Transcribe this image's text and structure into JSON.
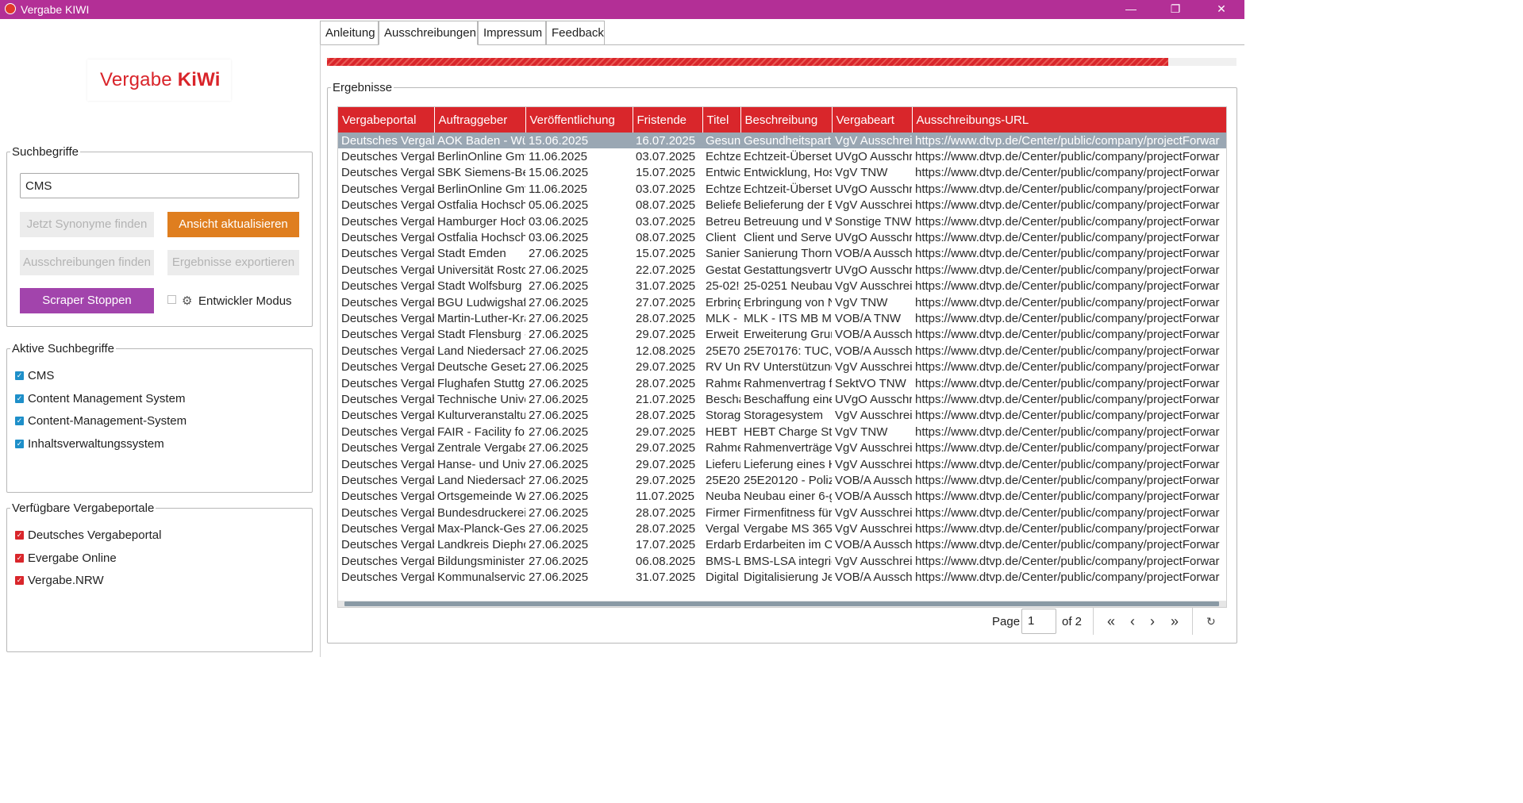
{
  "window": {
    "title": "Vergabe KIWI",
    "controls": {
      "minimize": "—",
      "maximize": "❐",
      "close": "✕"
    }
  },
  "logo": {
    "part1": "Vergabe ",
    "part2": "KiWi"
  },
  "suchbegriffe": {
    "legend": "Suchbegriffe",
    "input_value": "CMS",
    "btn_synonyme": "Jetzt Synonyme finden",
    "btn_aktualisieren": "Ansicht aktualisieren",
    "btn_finden": "Ausschreibungen finden",
    "btn_export": "Ergebnisse exportieren",
    "btn_stoppen": "Scraper Stoppen",
    "dev_mode": "Entwickler Modus"
  },
  "aktive": {
    "legend": "Aktive Suchbegriffe",
    "items": [
      "CMS",
      "Content Management System",
      "Content-Management-System",
      "Inhaltsverwaltungssystem"
    ]
  },
  "portale": {
    "legend": "Verfügbare Vergabeportale",
    "items": [
      "Deutsches Vergabeportal",
      "Evergabe Online",
      "Vergabe.NRW"
    ]
  },
  "tabs": [
    "Anleitung",
    "Ausschreibungen",
    "Impressum",
    "Feedback"
  ],
  "progress_fraction": 0.925,
  "ergebnisse": {
    "legend": "Ergebnisse",
    "columns": [
      "Vergabeportal",
      "Auftraggeber",
      "Veröffentlichung",
      "Fristende",
      "Titel",
      "Beschreibung",
      "Vergabeart",
      "Ausschreibungs-URL"
    ],
    "rows": [
      [
        "Deutsches Vergab",
        "AOK Baden - Wü",
        "15.06.2025",
        "16.07.2025",
        "Gesun",
        "Gesundheitspartr",
        "VgV Ausschrei",
        "https://www.dtvp.de/Center/public/company/projectForwar"
      ],
      [
        "Deutsches Vergab",
        "BerlinOnline Gmt",
        "11.06.2025",
        "03.07.2025",
        "Echtze",
        "Echtzeit-Übersetz",
        "UVgO Ausschr",
        "https://www.dtvp.de/Center/public/company/projectForwar"
      ],
      [
        "Deutsches Vergab",
        "SBK Siemens-Bet",
        "15.06.2025",
        "15.07.2025",
        "Entwic",
        "Entwicklung, Hos",
        "VgV TNW",
        "https://www.dtvp.de/Center/public/company/projectForwar"
      ],
      [
        "Deutsches Vergab",
        "BerlinOnline Gmt",
        "11.06.2025",
        "03.07.2025",
        "Echtze",
        "Echtzeit-Übersetz",
        "UVgO Ausschr",
        "https://www.dtvp.de/Center/public/company/projectForwar"
      ],
      [
        "Deutsches Vergab",
        "Ostfalia Hochsch",
        "05.06.2025",
        "08.07.2025",
        "Beliefe",
        "Belieferung der B",
        "VgV Ausschrei",
        "https://www.dtvp.de/Center/public/company/projectForwar"
      ],
      [
        "Deutsches Vergab",
        "Hamburger Hoch",
        "03.06.2025",
        "03.07.2025",
        "Betreu",
        "Betreuung und W",
        "Sonstige TNW",
        "https://www.dtvp.de/Center/public/company/projectForwar"
      ],
      [
        "Deutsches Vergab",
        "Ostfalia Hochsch",
        "03.06.2025",
        "08.07.2025",
        "Client",
        "Client und Server",
        "UVgO Ausschr",
        "https://www.dtvp.de/Center/public/company/projectForwar"
      ],
      [
        "Deutsches Vergab",
        "Stadt Emden",
        "27.06.2025",
        "15.07.2025",
        "Sanier",
        "Sanierung Thorn",
        "VOB/A Aussch",
        "https://www.dtvp.de/Center/public/company/projectForwar"
      ],
      [
        "Deutsches Vergab",
        "Universität Rostc",
        "27.06.2025",
        "22.07.2025",
        "Gestat",
        "Gestattungsvertr",
        "UVgO Ausschr",
        "https://www.dtvp.de/Center/public/company/projectForwar"
      ],
      [
        "Deutsches Vergab",
        "Stadt Wolfsburg",
        "27.06.2025",
        "31.07.2025",
        "25-02!",
        "25-0251 Neubau",
        "VgV Ausschrei",
        "https://www.dtvp.de/Center/public/company/projectForwar"
      ],
      [
        "Deutsches Vergab",
        "BGU Ludwigshafe",
        "27.06.2025",
        "27.07.2025",
        "Erbring",
        "Erbringung von N",
        "VgV TNW",
        "https://www.dtvp.de/Center/public/company/projectForwar"
      ],
      [
        "Deutsches Vergab",
        "Martin-Luther-Kra",
        "27.06.2025",
        "28.07.2025",
        "MLK -",
        "MLK - ITS MB Mk",
        "VOB/A TNW",
        "https://www.dtvp.de/Center/public/company/projectForwar"
      ],
      [
        "Deutsches Vergab",
        "Stadt Flensburg -",
        "27.06.2025",
        "29.07.2025",
        "Erweit",
        "Erweiterung Grur",
        "VOB/A Aussch",
        "https://www.dtvp.de/Center/public/company/projectForwar"
      ],
      [
        "Deutsches Vergab",
        "Land Niedersach:",
        "27.06.2025",
        "12.08.2025",
        "25E70",
        "25E70176: TUC, v",
        "VOB/A Aussch",
        "https://www.dtvp.de/Center/public/company/projectForwar"
      ],
      [
        "Deutsches Vergab",
        "Deutsche Gesetzl",
        "27.06.2025",
        "29.07.2025",
        "RV Un",
        "RV Unterstützung",
        "VgV Ausschrei",
        "https://www.dtvp.de/Center/public/company/projectForwar"
      ],
      [
        "Deutsches Vergab",
        "Flughafen Stuttg",
        "27.06.2025",
        "28.07.2025",
        "Rahme",
        "Rahmenvertrag f",
        "SektVO TNW",
        "https://www.dtvp.de/Center/public/company/projectForwar"
      ],
      [
        "Deutsches Vergab",
        "Technische Unive",
        "27.06.2025",
        "21.07.2025",
        "Bescha",
        "Beschaffung eine",
        "UVgO Ausschr",
        "https://www.dtvp.de/Center/public/company/projectForwar"
      ],
      [
        "Deutsches Vergab",
        "Kulturveranstaltu",
        "27.06.2025",
        "28.07.2025",
        "Storag",
        "Storagesystem",
        "VgV Ausschrei",
        "https://www.dtvp.de/Center/public/company/projectForwar"
      ],
      [
        "Deutsches Vergab",
        "FAIR - Facility for",
        "27.06.2025",
        "29.07.2025",
        "HEBT (",
        "HEBT Charge Stri",
        "VgV TNW",
        "https://www.dtvp.de/Center/public/company/projectForwar"
      ],
      [
        "Deutsches Vergab",
        "Zentrale Vergabe",
        "27.06.2025",
        "29.07.2025",
        "Rahme",
        "Rahmenverträge",
        "VgV Ausschrei",
        "https://www.dtvp.de/Center/public/company/projectForwar"
      ],
      [
        "Deutsches Vergab",
        "Hanse- und Univ",
        "27.06.2025",
        "29.07.2025",
        "Lieferu",
        "Lieferung eines H",
        "VgV Ausschrei",
        "https://www.dtvp.de/Center/public/company/projectForwar"
      ],
      [
        "Deutsches Vergab",
        "Land Niedersach:",
        "27.06.2025",
        "29.07.2025",
        "25E20",
        "25E20120 - Poliz",
        "VOB/A Aussch",
        "https://www.dtvp.de/Center/public/company/projectForwar"
      ],
      [
        "Deutsches Vergab",
        "Ortsgemeinde W",
        "27.06.2025",
        "11.07.2025",
        "Neuba",
        "Neubau einer 6-g",
        "VOB/A Aussch",
        "https://www.dtvp.de/Center/public/company/projectForwar"
      ],
      [
        "Deutsches Vergab",
        "Bundesdruckerei",
        "27.06.2025",
        "28.07.2025",
        "Firmer",
        "Firmenfitness für",
        "VgV Ausschrei",
        "https://www.dtvp.de/Center/public/company/projectForwar"
      ],
      [
        "Deutsches Vergab",
        "Max-Planck-Gese",
        "27.06.2025",
        "28.07.2025",
        "Vergal",
        "Vergabe MS 365",
        "VgV Ausschrei",
        "https://www.dtvp.de/Center/public/company/projectForwar"
      ],
      [
        "Deutsches Vergab",
        "Landkreis Diephc",
        "27.06.2025",
        "17.07.2025",
        "Erdarb",
        "Erdarbeiten im O",
        "VOB/A Aussch",
        "https://www.dtvp.de/Center/public/company/projectForwar"
      ],
      [
        "Deutsches Vergab",
        "Bildungsministeri",
        "27.06.2025",
        "06.08.2025",
        "BMS-L",
        "BMS-LSA integrie",
        "VgV Ausschrei",
        "https://www.dtvp.de/Center/public/company/projectForwar"
      ],
      [
        "Deutsches Vergab",
        "Kommunalservice",
        "27.06.2025",
        "31.07.2025",
        "Digital",
        "Digitalisierung Je",
        "VOB/A Aussch",
        "https://www.dtvp.de/Center/public/company/projectForwar"
      ]
    ]
  },
  "pager": {
    "page_label": "Page",
    "page_value": "1",
    "of_label": "of 2",
    "first": "«",
    "prev": "‹",
    "next": "›",
    "last": "»"
  }
}
